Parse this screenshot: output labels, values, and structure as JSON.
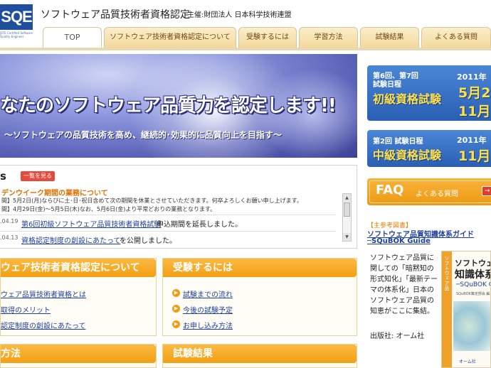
{
  "header": {
    "logo_text": "SQE",
    "logo_sub": "JSTE Certified Software Quality Engineer",
    "title": "ソフトウェア品質技術者資格認定",
    "org": "主催:財団法人 日本科学技術連盟"
  },
  "tabs": [
    {
      "label": "TOP",
      "active": true
    },
    {
      "label": "ソフトウェア技術者資格認定について"
    },
    {
      "label": "受験するには"
    },
    {
      "label": "学習方法"
    },
    {
      "label": "試験結果"
    },
    {
      "label": "よくある質問"
    }
  ],
  "hero": {
    "headline": "なたのソフトウェア品質力を認定します!!",
    "subline": "〜ソフトウェアの品質技術を高め、継続的･効果的に品質向上を目指す〜"
  },
  "banners": {
    "basic": {
      "line1": "第6回、第7回",
      "line2": "試験日程",
      "title": "初級資格試験",
      "year": "2011年",
      "date1": "5月2",
      "date2": "11月2"
    },
    "intermediate": {
      "line1": "第2回 試験日程",
      "title": "中級資格試験",
      "year": "2011年",
      "date": "11月2"
    }
  },
  "faq": {
    "title": "FAQ",
    "subtitle": "よくある質問",
    "button": "→"
  },
  "reference": {
    "tag": "【主参考図書】",
    "title_line1": "ソフトウェア品質知識体系ガイド",
    "title_line2": "─SQuBOK Guide",
    "description": "ソフトウェア品質に関しての「暗黙知の形式知化」「最新テーマの体系化」日本のソフトウェア品質の知恵がここに集結。",
    "publisher": "出版社: オーム社",
    "book_title1": "ソフトウェア品",
    "book_title2": "知識体系",
    "book_title3": "─SQuBOK G",
    "book_subtitle": "SQuBOK策定部会 編",
    "book_publisher": "オーム社"
  },
  "news": {
    "heading": "s",
    "more_button": "一覧を見る",
    "featured_title": "デンウイーク期間の業務について",
    "featured_line1": "間】5月2日(月)ならびに土･日･祝日含めて次の期間を休業とさせていただきます。何卒よろしくお願い申し上げます。",
    "featured_line2": "間】4月29日(金)〜5月5日(木)なお、5月6日(金)より平常どおりの業務となります。",
    "items": [
      {
        "date": ".04.19",
        "link": "第6回初級ソフトウェア品質技術者資格試験",
        "rest": " 申込期間を延長しました。"
      },
      {
        "date": ".04.13",
        "link": "資格認定制度の創設にあたって",
        "rest": "を公開しました。"
      }
    ],
    "scroll_up": "▲",
    "scroll_down": "▼"
  },
  "box_about": {
    "title": "ウェア技術者資格認定について",
    "items": [
      "ウェア品質技術者資格とは",
      "取得のメリット",
      "認定制度の創設にあたって"
    ]
  },
  "box_exam": {
    "title": "受験するには",
    "items": [
      "試験までの流れ",
      "今後の試験予定",
      "お申し込み方法"
    ],
    "icon": "▶"
  },
  "box_study": {
    "title": "方法"
  },
  "box_results": {
    "title": "試験結果"
  }
}
